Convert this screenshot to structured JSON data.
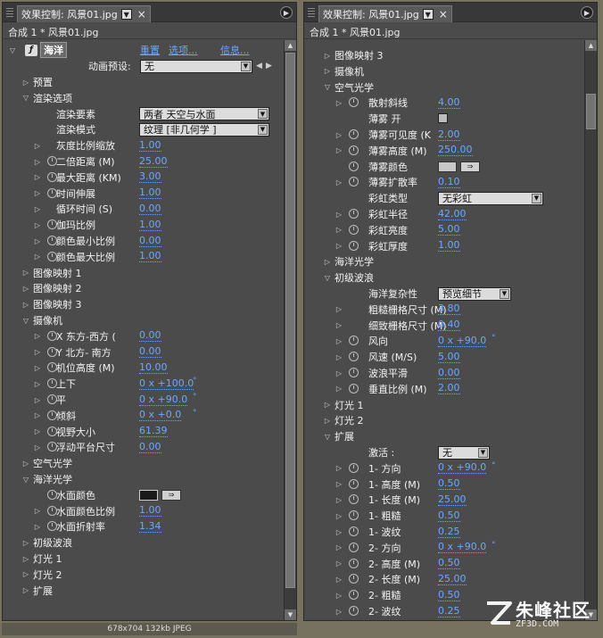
{
  "left_panel": {
    "tab_title": "效果控制: 风景01.jpg",
    "subtitle": "合成 1 * 风景01.jpg",
    "effect_name": "海洋",
    "reset_label": "重置",
    "options_label": "选项...",
    "about_label": "信息...",
    "preset_label": "动画预设:",
    "preset_value": "无",
    "rows": [
      {
        "indent": 1,
        "tri": "▷",
        "label": "预置"
      },
      {
        "indent": 1,
        "tri": "▽",
        "label": "渲染选项"
      },
      {
        "indent": 2,
        "label": "渲染要素",
        "dropdown": "两者  天空与水面"
      },
      {
        "indent": 2,
        "label": "渲染模式",
        "dropdown": "纹理  [非几何学  ]"
      },
      {
        "indent": 2,
        "tri": "▷",
        "label": "灰度比例缩放",
        "value": "1.00"
      },
      {
        "indent": 2,
        "tri": "▷",
        "sw": true,
        "label": "二倍距离 (M)",
        "value": "25.00"
      },
      {
        "indent": 2,
        "tri": "▷",
        "sw": true,
        "label": "最大距离 (KM)",
        "value": "3.00"
      },
      {
        "indent": 2,
        "tri": "▷",
        "sw": true,
        "label": "时间伸展",
        "value": "1.00"
      },
      {
        "indent": 2,
        "tri": "▷",
        "label": "循环时间 (S)",
        "value": "0.00"
      },
      {
        "indent": 2,
        "tri": "▷",
        "sw": true,
        "label": "伽玛比例",
        "value": "1.00"
      },
      {
        "indent": 2,
        "tri": "▷",
        "sw": true,
        "label": "颜色最小比例",
        "value": "0.00"
      },
      {
        "indent": 2,
        "tri": "▷",
        "sw": true,
        "label": "颜色最大比例",
        "value": "1.00"
      },
      {
        "indent": 1,
        "tri": "▷",
        "label": "图像映射 1"
      },
      {
        "indent": 1,
        "tri": "▷",
        "label": "图像映射 2"
      },
      {
        "indent": 1,
        "tri": "▷",
        "label": "图像映射 3"
      },
      {
        "indent": 1,
        "tri": "▽",
        "label": "摄像机"
      },
      {
        "indent": 2,
        "tri": "▷",
        "sw": true,
        "label": "X 东方-西方 (",
        "value": "0.00"
      },
      {
        "indent": 2,
        "tri": "▷",
        "sw": true,
        "label": "Y 北方- 南方",
        "value": "0.00"
      },
      {
        "indent": 2,
        "tri": "▷",
        "sw": true,
        "label": "机位高度 (M)",
        "value": "10.00"
      },
      {
        "indent": 2,
        "tri": "▷",
        "sw": true,
        "label": "上下",
        "value": "0 x +100.0",
        "deg": true
      },
      {
        "indent": 2,
        "tri": "▷",
        "sw": true,
        "label": "平",
        "value": "0 x +90.0",
        "deg": true
      },
      {
        "indent": 2,
        "tri": "▷",
        "sw": true,
        "label": "倾斜",
        "value": "0 x +0.0",
        "deg": true
      },
      {
        "indent": 2,
        "tri": "▷",
        "sw": true,
        "label": "视野大小",
        "value": "61.39"
      },
      {
        "indent": 2,
        "tri": "▷",
        "sw": true,
        "label": "浮动平台尺寸",
        "value": "0.00"
      },
      {
        "indent": 1,
        "tri": "▷",
        "label": "空气光学"
      },
      {
        "indent": 1,
        "tri": "▽",
        "label": "海洋光学"
      },
      {
        "indent": 2,
        "sw": true,
        "label": "水面颜色",
        "color": "black"
      },
      {
        "indent": 2,
        "tri": "▷",
        "sw": true,
        "label": "水面颜色比例",
        "value": "1.00"
      },
      {
        "indent": 2,
        "tri": "▷",
        "sw": true,
        "label": "水面折射率",
        "value": "1.34"
      },
      {
        "indent": 1,
        "tri": "▷",
        "label": "初级波浪"
      },
      {
        "indent": 1,
        "tri": "▷",
        "label": "灯光 1"
      },
      {
        "indent": 1,
        "tri": "▷",
        "label": "灯光 2"
      },
      {
        "indent": 1,
        "tri": "▷",
        "label": "扩展"
      }
    ]
  },
  "right_panel": {
    "tab_title": "效果控制: 风景01.jpg",
    "subtitle": "合成 1 * 风景01.jpg",
    "rows": [
      {
        "indent": 1,
        "tri": "▷",
        "label": "图像映射 3"
      },
      {
        "indent": 1,
        "tri": "▷",
        "label": "摄像机"
      },
      {
        "indent": 1,
        "tri": "▽",
        "label": "空气光学"
      },
      {
        "indent": 2,
        "tri": "▷",
        "sw": true,
        "label": "散射斜线",
        "value": "4.00"
      },
      {
        "indent": 2,
        "label": "薄雾 开",
        "checkbox": true
      },
      {
        "indent": 2,
        "tri": "▷",
        "sw": true,
        "label": "薄雾可见度 (K",
        "value": "2.00"
      },
      {
        "indent": 2,
        "tri": "▷",
        "sw": true,
        "label": "薄雾高度 (M)",
        "value": "250.00"
      },
      {
        "indent": 2,
        "sw": true,
        "label": "薄雾颜色",
        "color": "gray"
      },
      {
        "indent": 2,
        "tri": "▷",
        "sw": true,
        "label": "薄雾扩散率",
        "value": "0.10"
      },
      {
        "indent": 2,
        "label": "彩虹类型",
        "dropdown": "无彩虹"
      },
      {
        "indent": 2,
        "tri": "▷",
        "sw": true,
        "label": "彩虹半径",
        "value": "42.00"
      },
      {
        "indent": 2,
        "tri": "▷",
        "sw": true,
        "label": "彩虹亮度",
        "value": "5.00"
      },
      {
        "indent": 2,
        "tri": "▷",
        "sw": true,
        "label": "彩虹厚度",
        "value": "1.00"
      },
      {
        "indent": 1,
        "tri": "▷",
        "label": "海洋光学"
      },
      {
        "indent": 1,
        "tri": "▽",
        "label": "初级波浪"
      },
      {
        "indent": 2,
        "label": "海洋复杂性",
        "dropdown": "预览细节"
      },
      {
        "indent": 2,
        "tri": "▷",
        "label": "粗糙栅格尺寸 (M)",
        "value": "3.80"
      },
      {
        "indent": 2,
        "tri": "▷",
        "label": "细致栅格尺寸 (M)",
        "value": "0.40"
      },
      {
        "indent": 2,
        "tri": "▷",
        "sw": true,
        "label": "风向",
        "value": "0 x +90.0",
        "deg": true
      },
      {
        "indent": 2,
        "tri": "▷",
        "sw": true,
        "label": "风速 (M/S)",
        "value": "5.00"
      },
      {
        "indent": 2,
        "tri": "▷",
        "sw": true,
        "label": "波浪平滑",
        "value": "0.00"
      },
      {
        "indent": 2,
        "tri": "▷",
        "sw": true,
        "label": "垂直比例 (M)",
        "value": "2.00"
      },
      {
        "indent": 1,
        "tri": "▷",
        "label": "灯光 1"
      },
      {
        "indent": 1,
        "tri": "▷",
        "label": "灯光 2"
      },
      {
        "indent": 1,
        "tri": "▽",
        "label": "扩展"
      },
      {
        "indent": 2,
        "label": "激活 :",
        "dropdown": "无"
      },
      {
        "indent": 2,
        "tri": "▷",
        "sw": true,
        "label": "1- 方向",
        "value": "0 x +90.0",
        "deg": true
      },
      {
        "indent": 2,
        "tri": "▷",
        "sw": true,
        "label": "1- 高度  (M)",
        "value": "0.50"
      },
      {
        "indent": 2,
        "tri": "▷",
        "sw": true,
        "label": "1- 长度  (M)",
        "value": "25.00"
      },
      {
        "indent": 2,
        "tri": "▷",
        "sw": true,
        "label": "1- 粗糙",
        "value": "0.50"
      },
      {
        "indent": 2,
        "tri": "▷",
        "sw": true,
        "label": "1- 波纹",
        "value": "0.25"
      },
      {
        "indent": 2,
        "tri": "▷",
        "sw": true,
        "label": "2- 方向",
        "value": "0 x +90.0",
        "deg": true
      },
      {
        "indent": 2,
        "tri": "▷",
        "sw": true,
        "label": "2- 高度  (M)",
        "value": "0.50"
      },
      {
        "indent": 2,
        "tri": "▷",
        "sw": true,
        "label": "2- 长度  (M)",
        "value": "25.00"
      },
      {
        "indent": 2,
        "tri": "▷",
        "sw": true,
        "label": "2- 粗糙",
        "value": "0.50"
      },
      {
        "indent": 2,
        "tri": "▷",
        "sw": true,
        "label": "2- 波纹",
        "value": "0.25"
      }
    ]
  },
  "status_text": "678x704  132kb  JPEG",
  "watermark": {
    "main": "朱峰社区",
    "sub": "ZF3D.COM"
  },
  "colors": {
    "panel_bg": "#4b4b4b",
    "value_blue": "#6aa8ff",
    "frame": "#77725f"
  }
}
